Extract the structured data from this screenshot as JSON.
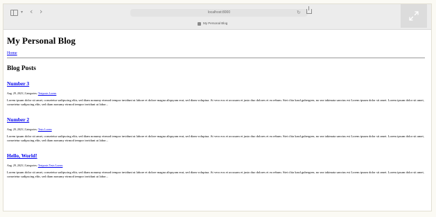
{
  "browser": {
    "url": "localhost:8000",
    "tab_title": "My Personal Blog"
  },
  "blog": {
    "title": "My Personal Blog",
    "nav_home": "Home",
    "section_title": "Blog Posts"
  },
  "posts": [
    {
      "title": "Number 3",
      "meta_prefix": "Aug. 29, 2023 | Categories:",
      "categories": "Testposts Lorem",
      "excerpt": "Lorem ipsum dolor sit amet, consetetur sadipscing elitr, sed diam nonumy eirmod tempor invidunt ut labore et dolore magna aliquyam erat, sed diam voluptua. At vero eos et accusam et justo duo dolores et ea rebum. Stet clita kasd gubergren, no sea takimata sanctus est Lorem ipsum dolor sit amet. Lorem ipsum dolor sit amet, consetetur sadipscing elitr, sed diam nonumy eirmod tempor invidunt ut labor..."
    },
    {
      "title": "Number 2",
      "meta_prefix": "Aug. 29, 2023 | Categories:",
      "categories": "Tests Lorem",
      "excerpt": "Lorem ipsum dolor sit amet, consetetur sadipscing elitr, sed diam nonumy eirmod tempor invidunt ut labore et dolore magna aliquyam erat, sed diam voluptua. At vero eos et accusam et justo duo dolores et ea rebum. Stet clita kasd gubergren, no sea takimata sanctus est Lorem ipsum dolor sit amet. Lorem ipsum dolor sit amet, consetetur sadipscing elitr, sed diam nonumy eirmod tempor invidunt ut labor..."
    },
    {
      "title": "Hello, World!",
      "meta_prefix": "Aug. 29, 2023 | Categories:",
      "categories": "Testposts Tests Lorem",
      "excerpt": "Lorem ipsum dolor sit amet, consetetur sadipscing elitr, sed diam nonumy eirmod tempor invidunt ut labore et dolore magna aliquyam erat, sed diam voluptua. At vero eos et accusam et justo duo dolores et ea rebum. Stet clita kasd gubergren, no sea takimata sanctus est Lorem ipsum dolor sit amet. Lorem ipsum dolor sit amet, consetetur sadipscing elitr, sed diam nonumy eirmod tempor invidunt ut labor..."
    }
  ],
  "icons": {
    "sidebar": "sidebar-toggle-icon",
    "back": "chevron-left-icon",
    "forward": "chevron-right-icon",
    "reload": "reload-icon",
    "share": "share-icon",
    "expand": "expand-icon"
  }
}
